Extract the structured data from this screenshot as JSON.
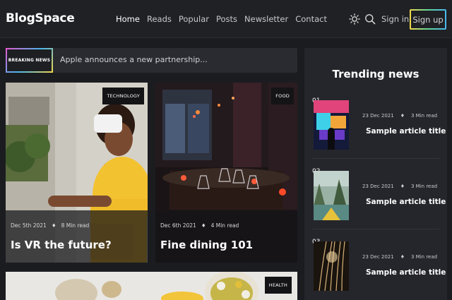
{
  "header": {
    "logo": "BlogSpace",
    "nav": [
      "Home",
      "Reads",
      "Popular",
      "Posts",
      "Newsletter",
      "Contact"
    ],
    "active_nav": "Home",
    "theme_icon": "sun-icon",
    "search_icon": "search-icon",
    "signin_label": "Sign in",
    "signup_label": "Sign up"
  },
  "breaking": {
    "badge": "BREAKING NEWS",
    "text": "Apple announces a new partnership..."
  },
  "cards": [
    {
      "tag": "TECHNOLOGY",
      "date": "Dec 5th 2021",
      "read": "8 Min read",
      "title": "Is VR the future?"
    },
    {
      "tag": "FOOD",
      "date": "Dec 6th 2021",
      "read": "4 Min read",
      "title": "Fine dining 101"
    },
    {
      "tag": "HEALTH"
    }
  ],
  "trending": {
    "title": "Trending news",
    "items": [
      {
        "num": "01",
        "date": "23 Dec 2021",
        "read": "3 Min read",
        "title": "Sample article title"
      },
      {
        "num": "02",
        "date": "23 Dec 2021",
        "read": "3 Min read",
        "title": "Sample article title"
      },
      {
        "num": "03",
        "date": "23 Dec 2021",
        "read": "3 Min read",
        "title": "Sample article title"
      }
    ]
  },
  "meta_separator": "♦",
  "colors": {
    "background": "#1b1c20",
    "header": "#202125",
    "panel": "#25262b",
    "accent_gradient": [
      "#f2d84a",
      "#63d79a",
      "#49b7ee"
    ]
  }
}
